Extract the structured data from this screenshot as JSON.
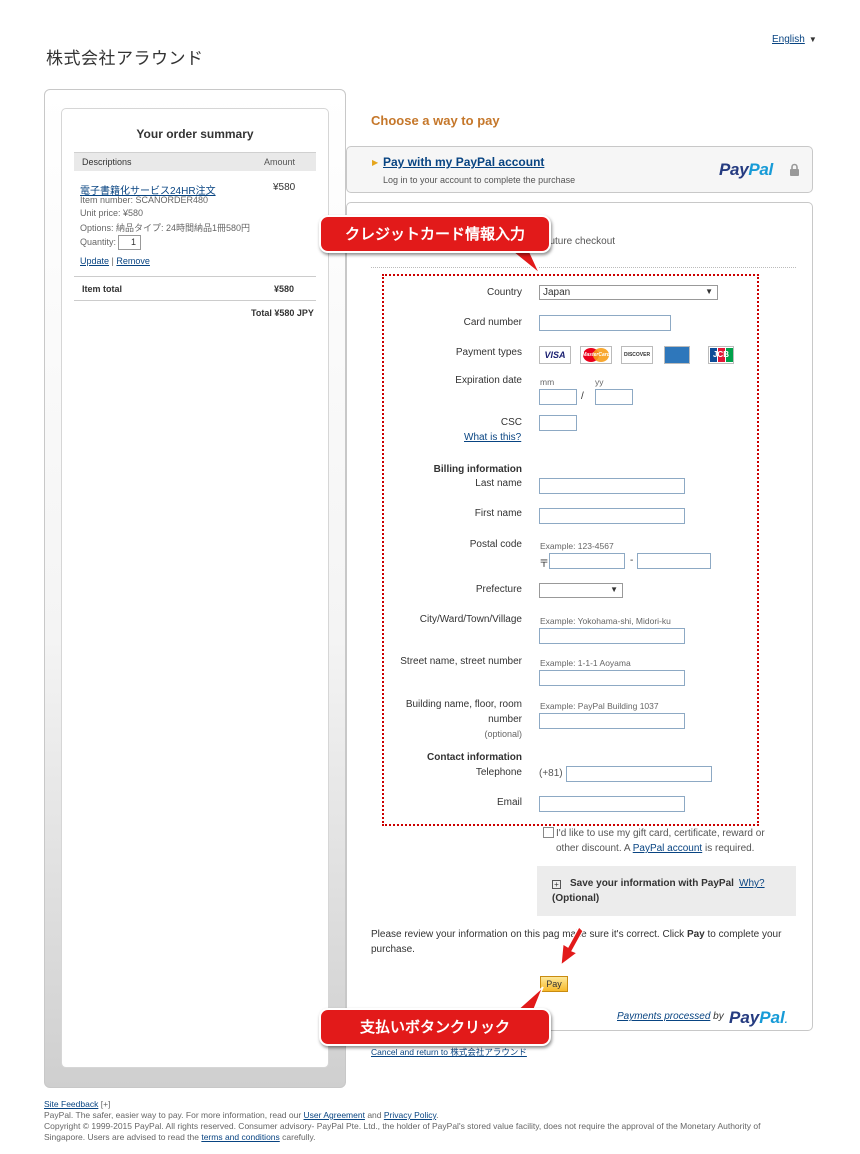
{
  "merchant": "株式会社アラウンド",
  "language": "English",
  "summary": {
    "title": "Your order summary",
    "col_desc": "Descriptions",
    "col_amount": "Amount",
    "item": {
      "name": "電子書籍化サービス24HR注文",
      "price": "¥580",
      "item_number": "Item number: SCANORDER480",
      "unit_price": "Unit price: ¥580",
      "options": "Options: 納品タイプ: 24時間納品1冊580円",
      "quantity_label": "Quantity:",
      "quantity": "1"
    },
    "update": "Update",
    "separator": "|",
    "remove": "Remove",
    "item_total_label": "Item total",
    "item_total": "¥580",
    "grand_total": "Total ¥580 JPY"
  },
  "choose_title": "Choose a way to pay",
  "paypal_account": {
    "link": "Pay with my PayPal account",
    "sub": "Log in to your account to complete the purchase",
    "logo_pay": "Pay",
    "logo_pal": "Pal"
  },
  "card": {
    "future_checkout": "er future checkout",
    "country_label": "Country",
    "country_value": "Japan",
    "card_number_label": "Card number",
    "payment_types_label": "Payment types",
    "payment_types": [
      "VISA",
      "MasterCard",
      "DISCOVER",
      "AMEX",
      "JCB"
    ],
    "expiration_label": "Expiration date",
    "mm": "mm",
    "yy": "yy",
    "slash": "/",
    "csc_label": "CSC",
    "what_is_this": "What is this?",
    "billing_heading": "Billing information",
    "last_name_label": "Last name",
    "first_name_label": "First name",
    "postal_label": "Postal code",
    "postal_example": "Example: 123-4567",
    "postal_mark": "〒",
    "postal_dash": "-",
    "prefecture_label": "Prefecture",
    "city_label": "City/Ward/Town/Village",
    "city_example": "Example: Yokohama-shi, Midori-ku",
    "street_label": "Street name, street number",
    "street_example": "Example: 1-1-1 Aoyama",
    "building_label_1": "Building name, floor, room",
    "building_label_2": "number",
    "building_optional": "(optional)",
    "building_example": "Example: PayPal Building 1037",
    "contact_heading": "Contact information",
    "telephone_label": "Telephone",
    "telephone_prefix": "(+81)",
    "email_label": "Email"
  },
  "gift": {
    "text_1": "I'd like to use my gift card, certificate, reward or other discount. A ",
    "link": "PayPal account",
    "text_2": " is required."
  },
  "save_info": {
    "plus": "+",
    "title": "Save your information with PayPal",
    "why": "Why?",
    "optional": "(Optional)"
  },
  "review": {
    "text_1": "Please review your information on this pag",
    "text_2": " make sure it's correct. Click ",
    "bold": "Pay",
    "text_3": " to complete your purchase."
  },
  "pay_button": "Pay",
  "processed": {
    "link": "Payments processed",
    "by": "by",
    "logo_pay": "Pay",
    "logo_pal": "Pal",
    "dot": "."
  },
  "cancel": "Cancel and return to 株式会社アラウンド",
  "callouts": {
    "card_info": "クレジットカード情報入力",
    "pay_click": "支払いボタンクリック"
  },
  "footer": {
    "feedback": "Site Feedback",
    "feedback_mark": "[+]",
    "line1_a": "PayPal. The safer, easier way to pay. For more information, read our ",
    "user_agreement": "User Agreement",
    "and": " and ",
    "privacy": "Privacy Policy",
    "period": ".",
    "line2": "Copyright © 1999-2015 PayPal. All rights reserved. Consumer advisory- PayPal Pte. Ltd., the holder of PayPal's stored value facility, does not require the approval of the Monetary Authority of",
    "line3_a": "Singapore. Users are advised to read the ",
    "terms": "terms and conditions",
    "line3_b": " carefully."
  },
  "colors": {
    "accent_orange": "#c5772a",
    "link_blue": "#084482",
    "callout_red": "#e21a1a",
    "paypal_dark": "#253b80",
    "paypal_light": "#179bd7"
  }
}
